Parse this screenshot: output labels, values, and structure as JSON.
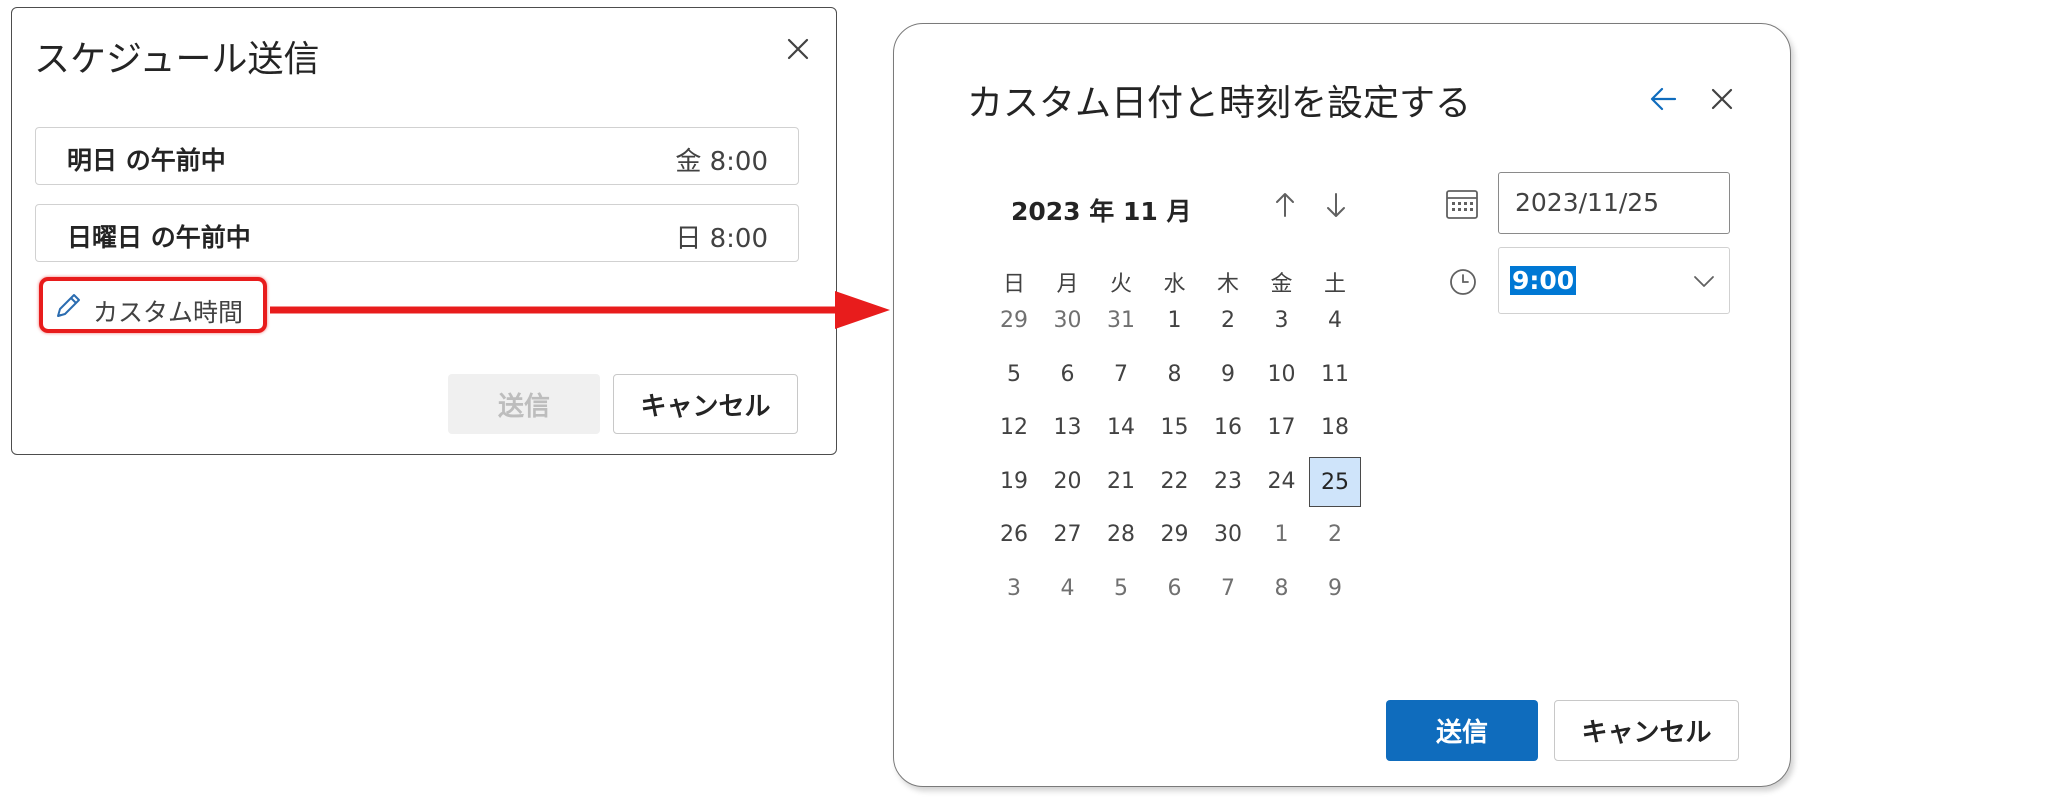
{
  "schedule_dialog": {
    "title": "スケジュール送信",
    "options": [
      {
        "label": "明日 の午前中",
        "time": "金 8:00"
      },
      {
        "label": "日曜日 の午前中",
        "time": "日 8:00"
      }
    ],
    "custom_time_label": "カスタム時間",
    "send_label": "送信",
    "cancel_label": "キャンセル"
  },
  "custom_dialog": {
    "title": "カスタム日付と時刻を設定する",
    "month_label": "2023 年 11 月",
    "weekdays": [
      "日",
      "月",
      "火",
      "水",
      "木",
      "金",
      "土"
    ],
    "weeks": [
      [
        "29",
        "30",
        "31",
        "1",
        "2",
        "3",
        "4"
      ],
      [
        "5",
        "6",
        "7",
        "8",
        "9",
        "10",
        "11"
      ],
      [
        "12",
        "13",
        "14",
        "15",
        "16",
        "17",
        "18"
      ],
      [
        "19",
        "20",
        "21",
        "22",
        "23",
        "24",
        "25"
      ],
      [
        "26",
        "27",
        "28",
        "29",
        "30",
        "1",
        "2"
      ],
      [
        "3",
        "4",
        "5",
        "6",
        "7",
        "8",
        "9"
      ]
    ],
    "selected_day": "25",
    "date_value": "2023/11/25",
    "time_value": "9:00",
    "send_label": "送信",
    "cancel_label": "キャンセル"
  },
  "colors": {
    "accent": "#0f6cbd",
    "highlight_red": "#e81c1c",
    "selected_day_bg": "#cfe4fa"
  },
  "icons": {
    "close": "close-icon",
    "back": "arrow-left-icon",
    "up": "arrow-up-icon",
    "down": "arrow-down-icon",
    "calendar": "calendar-icon",
    "clock": "clock-icon",
    "pencil": "pencil-icon",
    "chevron": "chevron-down-icon"
  }
}
